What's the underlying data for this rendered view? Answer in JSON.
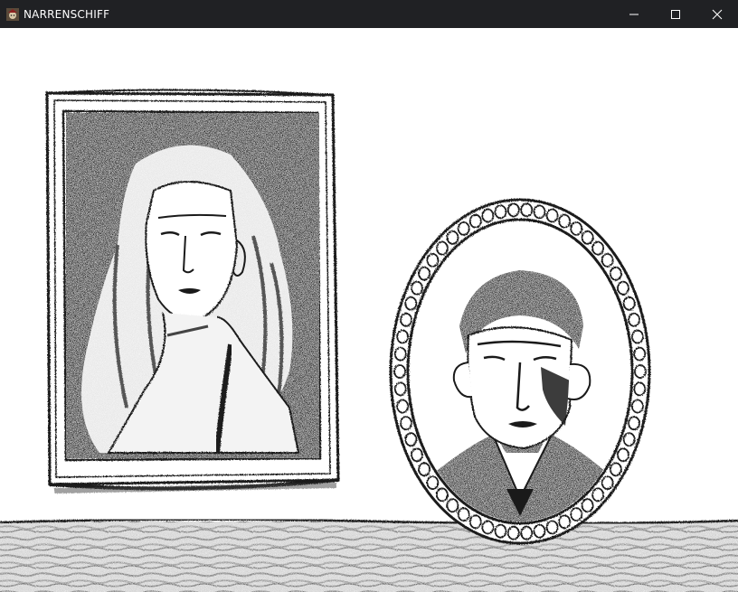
{
  "window": {
    "title": "NARRENSCHIFF",
    "icon": "jester-app-icon",
    "controls": [
      "minimize-icon",
      "maximize-icon",
      "close-icon"
    ],
    "colors": {
      "titlebar": "#202124",
      "title_text": "#ffffff",
      "canvas": "#ffffff",
      "ink": "#1a1a1a"
    }
  },
  "scene": {
    "objects": [
      "rectangular-portrait-woman",
      "oval-mirror-portrait-man",
      "charcoal-floor"
    ]
  }
}
